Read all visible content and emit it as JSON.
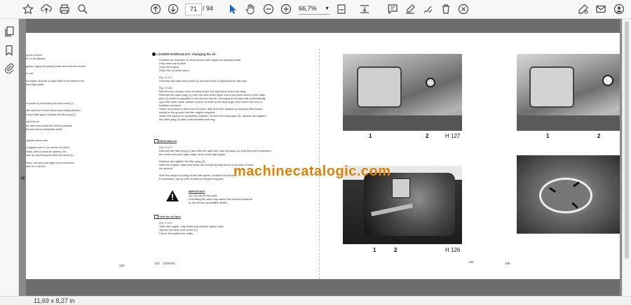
{
  "toolbar": {
    "page_current": "71",
    "page_separator": "/",
    "page_total": "94",
    "zoom": "66,7%",
    "icons": [
      "star-icon",
      "upload-icon",
      "print-icon",
      "zoom-search-icon",
      "page-up-icon",
      "page-down-icon",
      "select-cursor-icon",
      "hand-icon",
      "zoom-out-icon",
      "zoom-in-icon",
      "fit-page-icon",
      "scroll-mode-icon",
      "comment-icon",
      "highlight-icon",
      "draw-icon",
      "delete-icon",
      "rotate-icon",
      "sign-icon",
      "mail-icon",
      "account-icon"
    ]
  },
  "sidebar": {
    "icons": [
      "pages-icon",
      "bookmark-icon",
      "attachment-icon"
    ]
  },
  "document": {
    "watermark": "machinecatalogic.com",
    "left_page": {
      "heading": "LOADER HYDRAULICS: Changing the oil",
      "body_lines": [
        "Position the machine on level ground and apply the parking brake.",
        "Fully raise the bucket.",
        "Stop the engine.",
        "Drain the oil when warm.",
        "",
        "Fig. H 127",
        "Unscrew the tank vent screw (1) several turns to depressurize the tank.",
        "",
        "Fig. H 126",
        "Remove the access cover located under the right hand rear mud wing.",
        "Remove the drain plug (1) from the tank drain valve and in its place screw in the drain",
        "pipe (2) which is supplied in the service tool kit. Screwing in the pipe will automatically",
        "open the drain valve. Attach a piece of hose to the drain pipe and collect the oil in a",
        "suitable container.",
        "When oil ceases to flow from the tank, fully drain the system by lowering the bucket",
        "slowly to the ground with the engine stopped.",
        "When the system is completely drained, remove the drain pipe (2), replace and tighten",
        "the drain plug (1) with a serviceable seal ring."
      ],
      "refill_heading": "Refill with oil",
      "refill_lines": [
        "Fig. H 127",
        "Remove the filler plug (2) and refill the tank with new hydraulic oil until the level is between",
        "the centre and the upper edge of the level sight glass.",
        "",
        "Replace and tighten the filler plug (2).",
        "Start the engine, raise and lower the bucket several times from lower 8 units",
        "the ground.",
        "",
        "With the engine running at low idle speed, recheck the oil level.",
        "If necessary, top up with oil with the engine stopped."
      ],
      "warning_title": "IMPORTANT",
      "warning_lines": [
        "Do not overfill the tank!",
        "Overfilling the tank may cause the internal pressure",
        "to rise above acceptable limits!"
      ],
      "vent_heading": "Vent the oil tank",
      "vent_lines": [
        "Fig. H 127",
        "Start the engine, fully extend all cylinder piston rods.",
        "Tighten the tank vent screw (1).",
        "Check the system for leaks."
      ],
      "page_number": "134",
      "doc_code": "1439 E/1",
      "prev_page_number": "132",
      "left_margin_lines": [
        "ng the oil level",
        "ks on the dipstick",
        "",
        "ground, apply the parking brake and lower the bucket",
        "",
        "in cold.",
        "",
        "he engine oil at the oil drain valve to be between the",
        "level sight glass.",
        "",
        "",
        "",
        "",
        "oil cooler by unscrewing the vent screw (1)",
        "",
        "with sprinkler oil with all the level setting (inboard",
        "e level sight glass. Replace the filler plug (2).",
        "",
        "uired the oil",
        "the tank must cause the internal pressure",
        "the tank above acceptable limits!",
        "",
        "",
        "cylinder piston rods",
        "",
        "ic (tighten even to (to correct out when)",
        "brake, (still oil (turbo fix system), the",
        "tank by unscrewing the tank vent screw (1).",
        "",
        "heery, the tank must again for unconvinced",
        "tank on in service."
      ]
    },
    "right_page": {
      "fig_left_top": {
        "caption": "H 127",
        "labels": [
          "1",
          "2"
        ]
      },
      "fig_left_bottom": {
        "caption": "H 126",
        "labels": [
          "1",
          "2"
        ]
      },
      "fig_right_top": {
        "labels": [
          "1",
          "2"
        ]
      },
      "page_number_left": "135",
      "page_number_right": "136"
    }
  },
  "status": {
    "page_size": "11,69 x 8,27 in"
  }
}
